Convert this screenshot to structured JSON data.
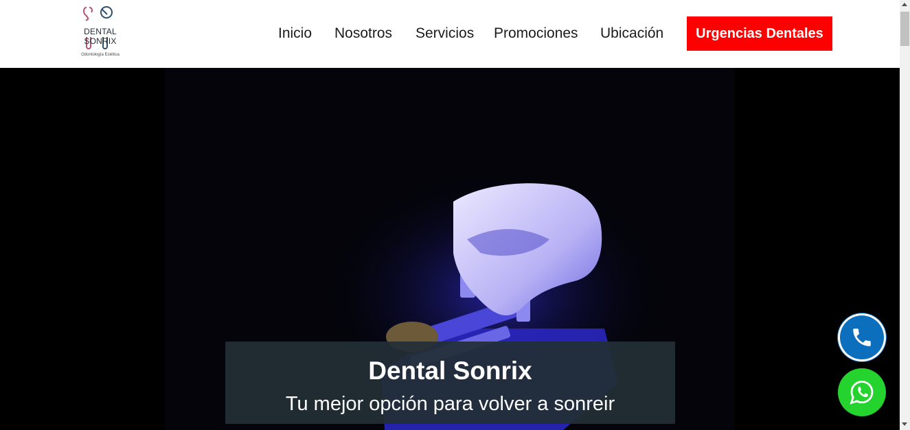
{
  "brand": {
    "name": "DENTAL SONRIX",
    "tagline": "Odontología Estética",
    "logo_colors": {
      "tooth_left": "#b5546e",
      "tooth_right": "#2f4f6b"
    }
  },
  "nav": {
    "items": [
      {
        "label": "Inicio"
      },
      {
        "label": "Nosotros"
      },
      {
        "label": "Servicios"
      },
      {
        "label": "Promociones"
      },
      {
        "label": "Ubicación"
      }
    ],
    "cta_label": "Urgencias Dentales",
    "cta_color": "#ff0000"
  },
  "hero": {
    "title": "Dental Sonrix",
    "subtitle": "Tu mejor opción para volver a sonreir",
    "image": "dental-model-blue-light"
  },
  "floating": {
    "phone_icon": "phone-icon",
    "phone_color": "#0c6fbd",
    "whatsapp_icon": "whatsapp-icon",
    "whatsapp_color": "#25d32e"
  }
}
